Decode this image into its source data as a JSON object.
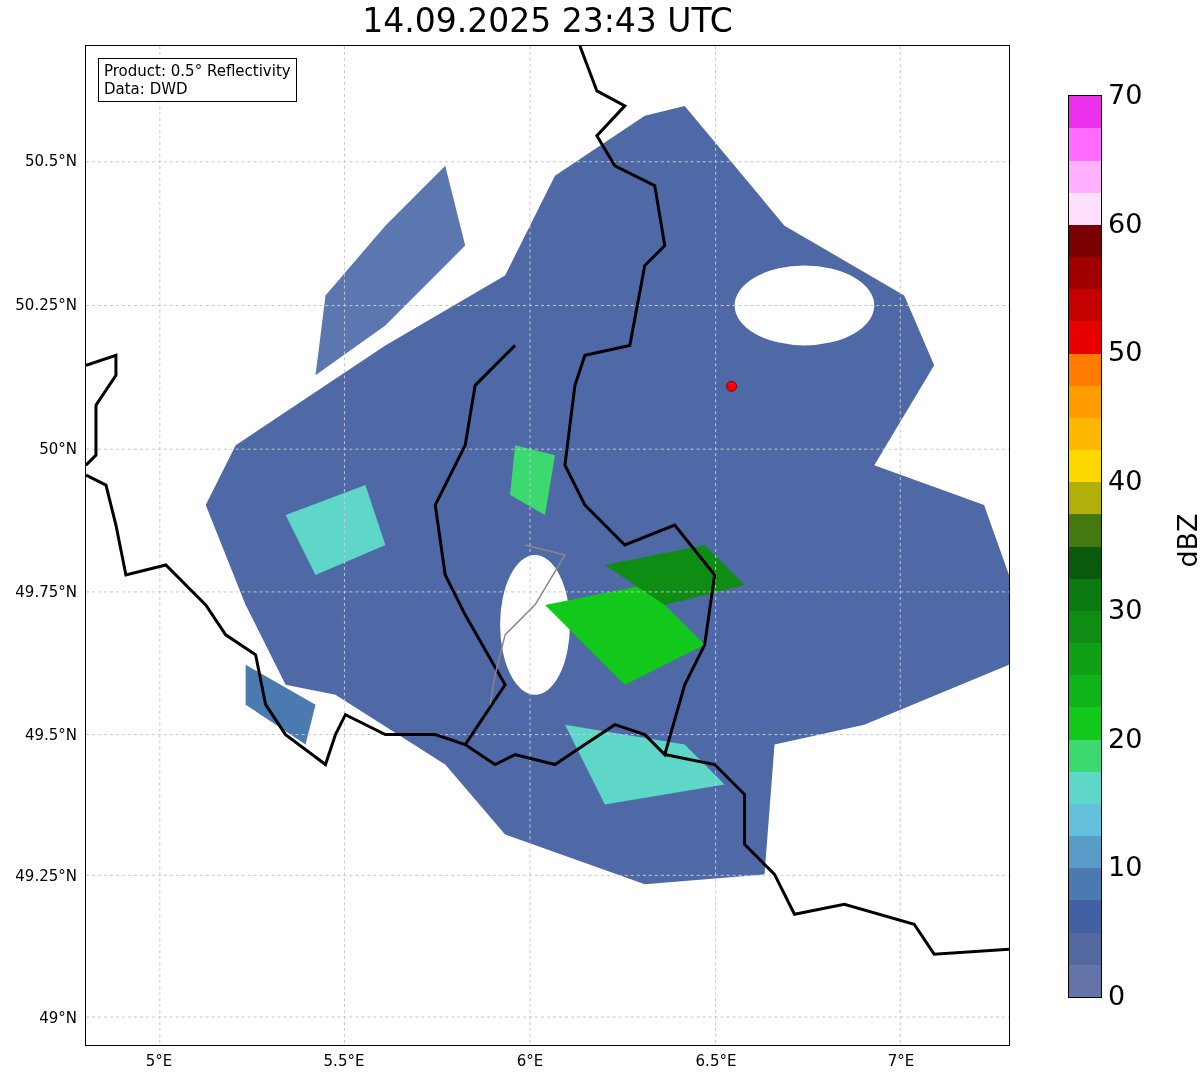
{
  "title": "14.09.2025 23:43 UTC",
  "legend": {
    "lines": [
      "Product: 0.5° Reflectivity",
      "Data: DWD"
    ]
  },
  "y_ticks": [
    "50.5°N",
    "50.25°N",
    "50°N",
    "49.75°N",
    "49.5°N",
    "49.25°N",
    "49°N"
  ],
  "x_ticks": [
    "5°E",
    "5.5°E",
    "6°E",
    "6.5°E",
    "7°E"
  ],
  "colorbar": {
    "label": "dBZ",
    "ticks": [
      "70",
      "60",
      "50",
      "40",
      "30",
      "20",
      "10",
      "0"
    ],
    "segments": [
      {
        "color": "#6474a8"
      },
      {
        "color": "#5468a0"
      },
      {
        "color": "#4460a4"
      },
      {
        "color": "#4a7ab0"
      },
      {
        "color": "#5a9cc8"
      },
      {
        "color": "#64c0dc"
      },
      {
        "color": "#5ed6c8"
      },
      {
        "color": "#3cd870"
      },
      {
        "color": "#12c81a"
      },
      {
        "color": "#10b41a"
      },
      {
        "color": "#10a016"
      },
      {
        "color": "#0e8c14"
      },
      {
        "color": "#0c7a12"
      },
      {
        "color": "#0a5a0e"
      },
      {
        "color": "#467810"
      },
      {
        "color": "#b0b008"
      },
      {
        "color": "#ffd800"
      },
      {
        "color": "#ffb800"
      },
      {
        "color": "#ff9c00"
      },
      {
        "color": "#ff7c00"
      },
      {
        "color": "#e80000"
      },
      {
        "color": "#c40000"
      },
      {
        "color": "#a00000"
      },
      {
        "color": "#780000"
      },
      {
        "color": "#ffe0ff"
      },
      {
        "color": "#ffb0ff"
      },
      {
        "color": "#ff6cff"
      },
      {
        "color": "#ea30ea"
      }
    ]
  }
}
